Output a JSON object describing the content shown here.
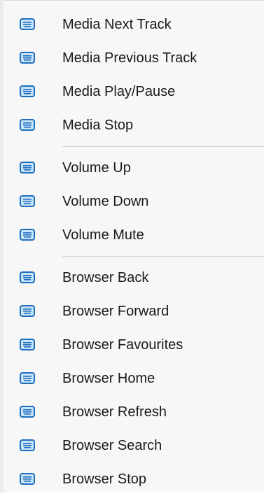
{
  "menu": {
    "groups": [
      {
        "items": [
          {
            "label": "Media Next Track",
            "icon": "keyboard-icon"
          },
          {
            "label": "Media Previous Track",
            "icon": "keyboard-icon"
          },
          {
            "label": "Media Play/Pause",
            "icon": "keyboard-icon"
          },
          {
            "label": "Media Stop",
            "icon": "keyboard-icon"
          }
        ]
      },
      {
        "items": [
          {
            "label": "Volume Up",
            "icon": "keyboard-icon"
          },
          {
            "label": "Volume Down",
            "icon": "keyboard-icon"
          },
          {
            "label": "Volume Mute",
            "icon": "keyboard-icon"
          }
        ]
      },
      {
        "items": [
          {
            "label": "Browser Back",
            "icon": "keyboard-icon"
          },
          {
            "label": "Browser Forward",
            "icon": "keyboard-icon"
          },
          {
            "label": "Browser Favourites",
            "icon": "keyboard-icon"
          },
          {
            "label": "Browser Home",
            "icon": "keyboard-icon"
          },
          {
            "label": "Browser Refresh",
            "icon": "keyboard-icon"
          },
          {
            "label": "Browser Search",
            "icon": "keyboard-icon"
          },
          {
            "label": "Browser Stop",
            "icon": "keyboard-icon"
          }
        ]
      }
    ]
  },
  "colors": {
    "icon_fill": "#c9e3f7",
    "icon_stroke": "#1f6fbf",
    "text": "#1a1a1a"
  }
}
